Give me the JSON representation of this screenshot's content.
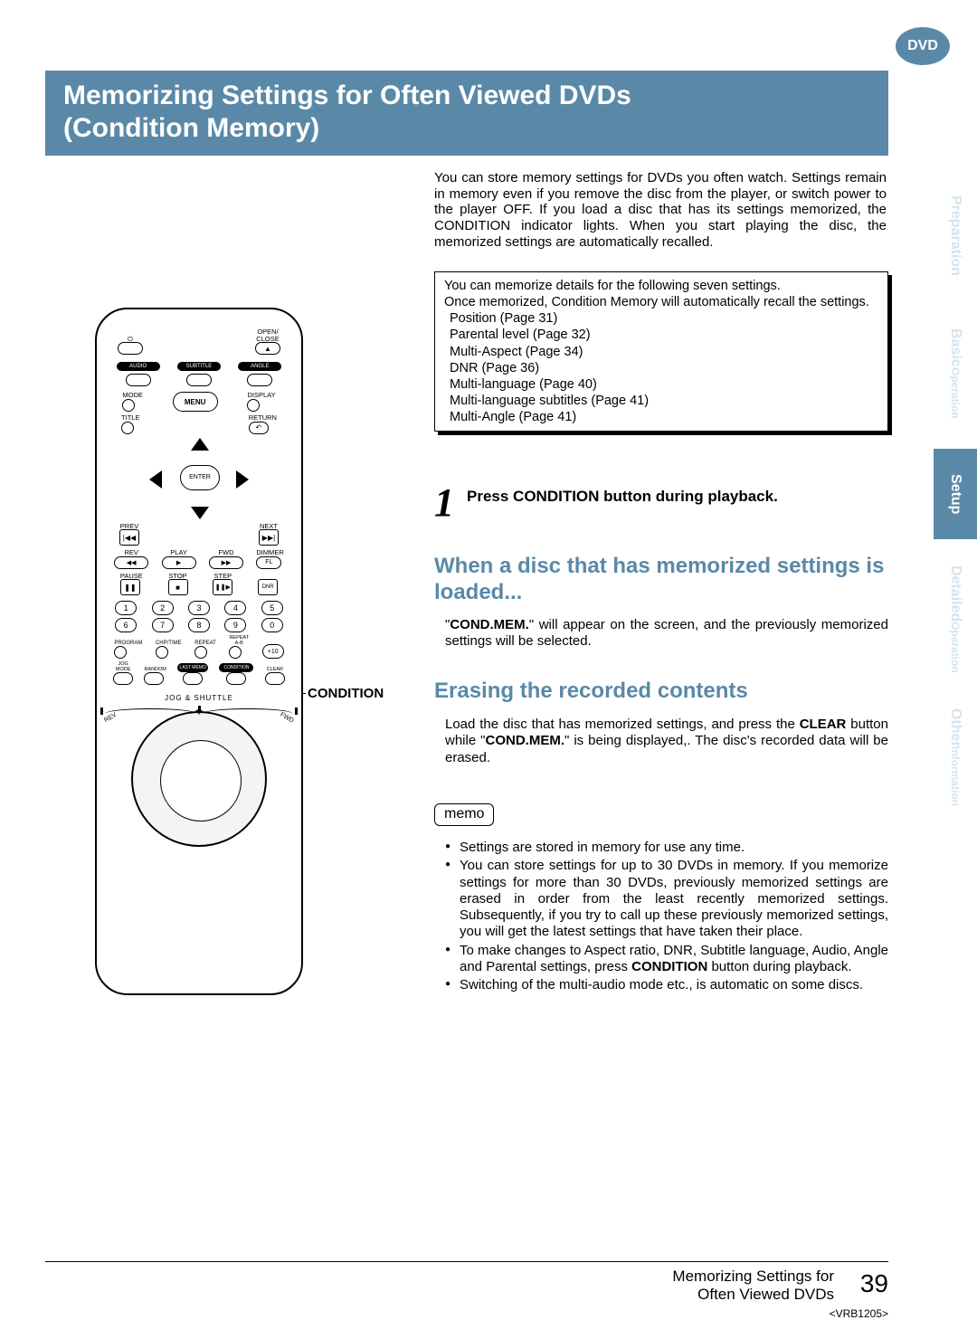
{
  "logo": "DVD",
  "title_line1": "Memorizing Settings for Often Viewed DVDs",
  "title_line2": "(Condition Memory)",
  "intro": "You can store memory settings for DVDs you often watch. Settings remain in memory even if you remove the disc from the player, or switch power to the player OFF. If you load a disc that has its settings memorized, the CONDITION indicator lights. When you start playing the disc, the memorized settings are automatically recalled.",
  "settings_box": {
    "lead1": "You can memorize details for the following seven settings.",
    "lead2": "Once memorized, Condition Memory will automatically recall the settings.",
    "items": [
      "Position (Page 31)",
      "Parental level (Page 32)",
      "Multi-Aspect (Page 34)",
      "DNR (Page 36)",
      "Multi-language (Page 40)",
      "Multi-language subtitles (Page 41)",
      "Multi-Angle (Page 41)"
    ]
  },
  "step": {
    "num": "1",
    "text": "Press CONDITION button during playback."
  },
  "subheading1": "When a disc that has memorized settings is loaded...",
  "cond_p_pre": "\"",
  "cond_p_bold": "COND.MEM.",
  "cond_p_post": "\" will appear on the screen, and the previously memorized settings will be selected.",
  "subheading2": "Erasing the recorded contents",
  "erase_p_pre": "Load the disc that has memorized settings, and press the ",
  "erase_p_bold1": "CLEAR",
  "erase_p_mid": " button while \"",
  "erase_p_bold2": "COND.MEM.",
  "erase_p_post": "\" is being displayed,. The disc's recorded data will be erased.",
  "memo_label": "memo",
  "memo": {
    "m1": "Settings are stored in memory for use any time.",
    "m2": "You can store settings for up to 30 DVDs in memory. If you memorize settings for more than 30 DVDs, previously memorized settings are erased in order from the least recently memorized settings. Subsequently, if you try to call up these previously memorized settings, you will get the latest settings that have taken their place.",
    "m3_pre": "To make changes to Aspect ratio, DNR, Subtitle language, Audio, Angle and Parental settings, press ",
    "m3_bold": "CONDITION",
    "m3_post": " button during playback.",
    "m4": "Switching of the multi-audio mode etc., is automatic on some discs."
  },
  "remote_label": "CONDITION",
  "remote": {
    "open_close": "OPEN/\nCLOSE",
    "audio": "AUDIO",
    "subtitle": "SUBTITLE",
    "angle": "ANGLE",
    "mode": "MODE",
    "menu": "MENU",
    "display": "DISPLAY",
    "title": "TITLE",
    "return": "RETURN",
    "enter": "ENTER",
    "prev": "PREV",
    "next": "NEXT",
    "rev": "REV",
    "play": "PLAY",
    "fwd": "FWD",
    "dimmer": "DIMMER",
    "fl": "FL",
    "pause": "PAUSE",
    "stop": "STOP",
    "step": "STEP",
    "dnr": "DNR",
    "nums": [
      "1",
      "2",
      "3",
      "4",
      "5",
      "6",
      "7",
      "8",
      "9",
      "0"
    ],
    "program": "PROGRAM",
    "chptime": "CHP/TIME",
    "repeat": "REPEAT",
    "repeat_ab": "REPEAT\nA-B",
    "plus10": "+10",
    "jogmode": "JOG\nMODE",
    "random": "RANDOM",
    "lastmemo": "LAST MEMO",
    "condition": "CONDITION",
    "clear": "CLEAR",
    "jogshuttle": "JOG & SHUTTLE",
    "jrev": "REV",
    "jfwd": "FWD"
  },
  "side_tabs": {
    "preparation": "Preparation",
    "basic": "Basic",
    "basic_sub": "Operation",
    "setup": "Setup",
    "detailed": "Detailed",
    "detailed_sub": "Operation",
    "other": "Other",
    "other_sub": "Information"
  },
  "footer": {
    "line1": "Memorizing Settings for",
    "line2": "Often Viewed DVDs",
    "page": "39",
    "code": "<VRB1205>"
  }
}
